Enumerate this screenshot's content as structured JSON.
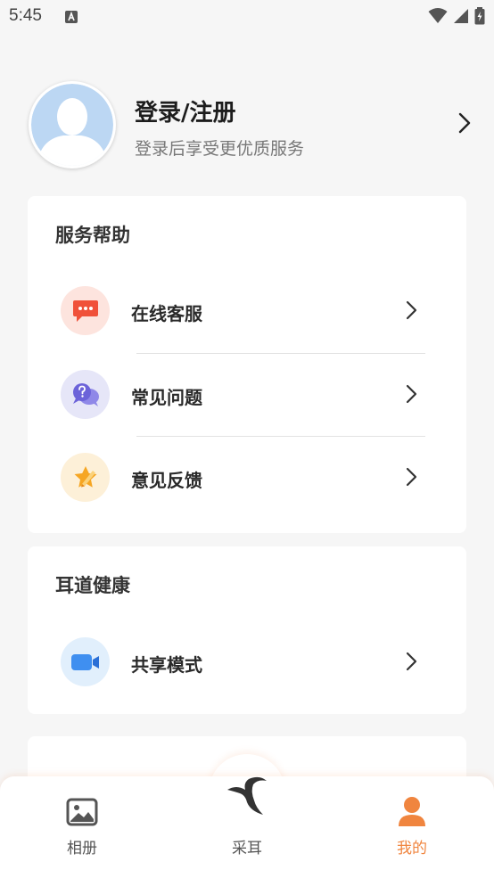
{
  "status_bar": {
    "time": "5:45"
  },
  "profile": {
    "title": "登录/注册",
    "subtitle": "登录后享受更优质服务"
  },
  "service_help": {
    "title": "服务帮助",
    "items": [
      {
        "label": "在线客服",
        "icon": "chat-bubble-icon"
      },
      {
        "label": "常见问题",
        "icon": "question-bubble-icon"
      },
      {
        "label": "意见反馈",
        "icon": "star-pencil-icon"
      }
    ]
  },
  "ear_health": {
    "title": "耳道健康",
    "items": [
      {
        "label": "共享模式",
        "icon": "video-camera-icon"
      }
    ]
  },
  "tabbar": {
    "tabs": [
      {
        "label": "相册",
        "icon": "photo-album-icon",
        "active": false
      },
      {
        "label": "采耳",
        "icon": "bird-logo-icon",
        "active": false
      },
      {
        "label": "我的",
        "icon": "person-icon",
        "active": true
      }
    ]
  },
  "colors": {
    "accent": "#f0853f",
    "background": "#f6f6f6"
  }
}
